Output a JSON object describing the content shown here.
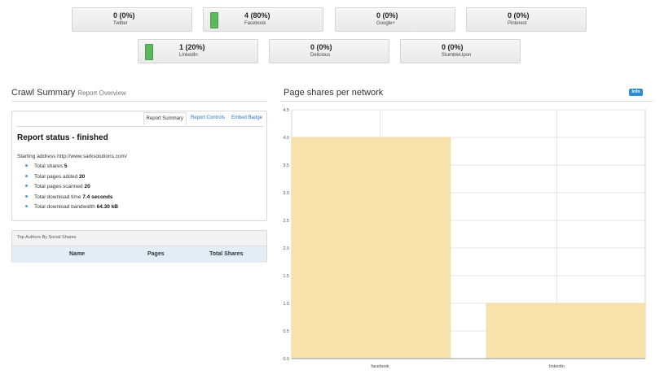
{
  "network_tiles": [
    {
      "count": "0 (0%)",
      "network": "Twitter",
      "has_bar": false
    },
    {
      "count": "4 (80%)",
      "network": "Facebook",
      "has_bar": true
    },
    {
      "count": "0 (0%)",
      "network": "Google+",
      "has_bar": false
    },
    {
      "count": "0 (0%)",
      "network": "Pinterest",
      "has_bar": false
    },
    {
      "count": "1 (20%)",
      "network": "LinkedIn",
      "has_bar": true
    },
    {
      "count": "0 (0%)",
      "network": "Delicious",
      "has_bar": false
    },
    {
      "count": "0 (0%)",
      "network": "StumbleUpon",
      "has_bar": false
    }
  ],
  "crawl_summary": {
    "title": "Crawl Summary",
    "subtitle": "Report Overview",
    "tabs": [
      "Report Summary",
      "Report Controls",
      "Embed Badge"
    ],
    "active_tab": "Report Summary",
    "status_heading": "Report status - finished",
    "starting_address": "Starting address http://www.sarksolutions.com/",
    "stats": [
      {
        "label": "Total shares",
        "value": "5"
      },
      {
        "label": "Total pages added",
        "value": "20"
      },
      {
        "label": "Total pages scanned",
        "value": "20"
      },
      {
        "label": "Total download time",
        "value": "7.4 seconds"
      },
      {
        "label": "Total download bandwidth",
        "value": "64.30 kB"
      }
    ]
  },
  "top_authors": {
    "title": "Top Authors By Social Shares",
    "columns": [
      "Name",
      "Pages",
      "Total Shares"
    ]
  },
  "page_shares": {
    "title": "Page shares per network",
    "info_badge": "Info"
  },
  "colors": {
    "bar_fill": "#f7e3ab",
    "tile_bar": "#5cb85c",
    "link": "#2a78c6",
    "info_badge": "#2a8fd0"
  },
  "chart_data": {
    "type": "bar",
    "categories": [
      "facebook",
      "linkedin"
    ],
    "values": [
      4,
      1
    ],
    "ylim": [
      0,
      4.5
    ],
    "yticks": [
      "0.0",
      "0.5",
      "1.0",
      "1.5",
      "2.0",
      "2.5",
      "3.0",
      "3.5",
      "4.0",
      "4.5"
    ],
    "grid": true
  }
}
